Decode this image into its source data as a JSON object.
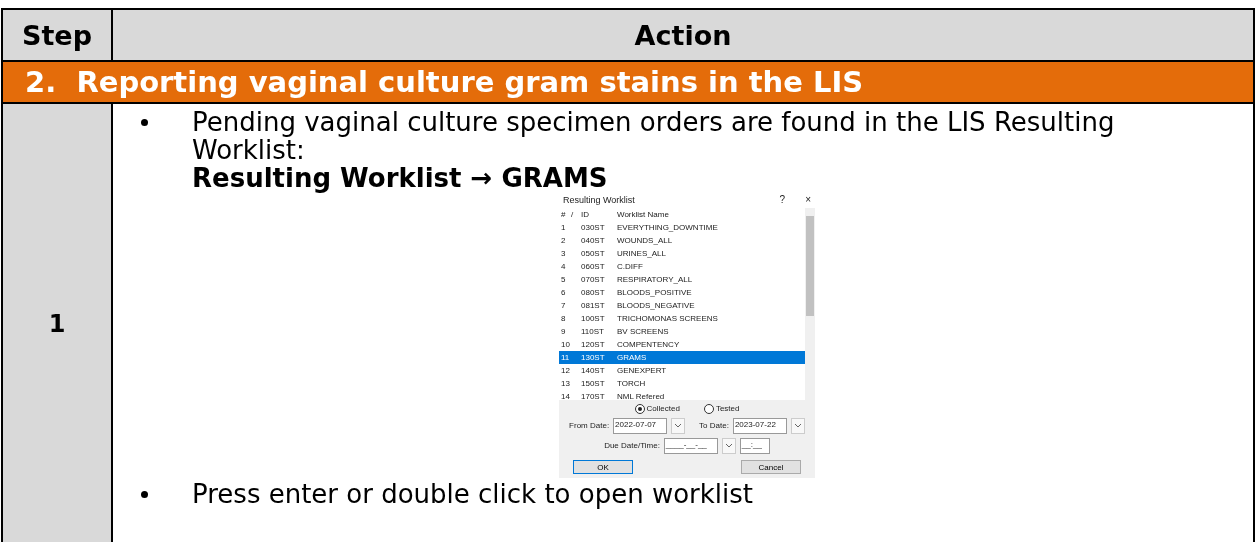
{
  "table": {
    "columns": [
      "Step",
      "Action"
    ],
    "section": "2.  Reporting vaginal culture gram stains in the LIS",
    "rows": [
      {
        "step": "1",
        "bullets": [
          "Pending vaginal culture specimen orders are found in the LIS Resulting Worklist:"
        ],
        "path": "**Resulting Worklist → GRAMS**",
        "dialog": {
          "title": "Resulting Worklist",
          "help": "?",
          "close": "×",
          "columns": [
            "#",
            "/",
            "ID",
            "Worklist Name"
          ],
          "items": [
            {
              "num": "1",
              "id": "030ST",
              "name": "EVERYTHING_DOWNTIME",
              "selected": false
            },
            {
              "num": "2",
              "id": "040ST",
              "name": "WOUNDS_ALL",
              "selected": false
            },
            {
              "num": "3",
              "id": "050ST",
              "name": "URINES_ALL",
              "selected": false
            },
            {
              "num": "4",
              "id": "060ST",
              "name": "C.DIFF",
              "selected": false
            },
            {
              "num": "5",
              "id": "070ST",
              "name": "RESPIRATORY_ALL",
              "selected": false
            },
            {
              "num": "6",
              "id": "080ST",
              "name": "BLOODS_POSITIVE",
              "selected": false
            },
            {
              "num": "7",
              "id": "081ST",
              "name": "BLOODS_NEGATIVE",
              "selected": false
            },
            {
              "num": "8",
              "id": "100ST",
              "name": "TRICHOMONAS SCREENS",
              "selected": false
            },
            {
              "num": "9",
              "id": "110ST",
              "name": "BV SCREENS",
              "selected": false
            },
            {
              "num": "10",
              "id": "120ST",
              "name": "COMPENTENCY",
              "selected": false
            },
            {
              "num": "11",
              "id": "130ST",
              "name": "GRAMS",
              "selected": true
            },
            {
              "num": "12",
              "id": "140ST",
              "name": "GENEXPERT",
              "selected": false
            },
            {
              "num": "13",
              "id": "150ST",
              "name": "TORCH",
              "selected": false
            },
            {
              "num": "14",
              "id": "170ST",
              "name": "NML Refered",
              "selected": false
            }
          ],
          "radios": [
            {
              "label": "Collected",
              "selected": true
            },
            {
              "label": "Tested",
              "selected": false
            }
          ],
          "from_label": "From Date:",
          "from_value": "2022-07-07",
          "to_label": "To Date:",
          "to_value": "2023-07-22",
          "due_label": "Due Date/Time:",
          "due_value": "____-__-__",
          "time_value": "__:__",
          "ok": "OK",
          "cancel": "Cancel"
        },
        "after": [
          "Press enter or double click to open worklist"
        ]
      }
    ]
  }
}
